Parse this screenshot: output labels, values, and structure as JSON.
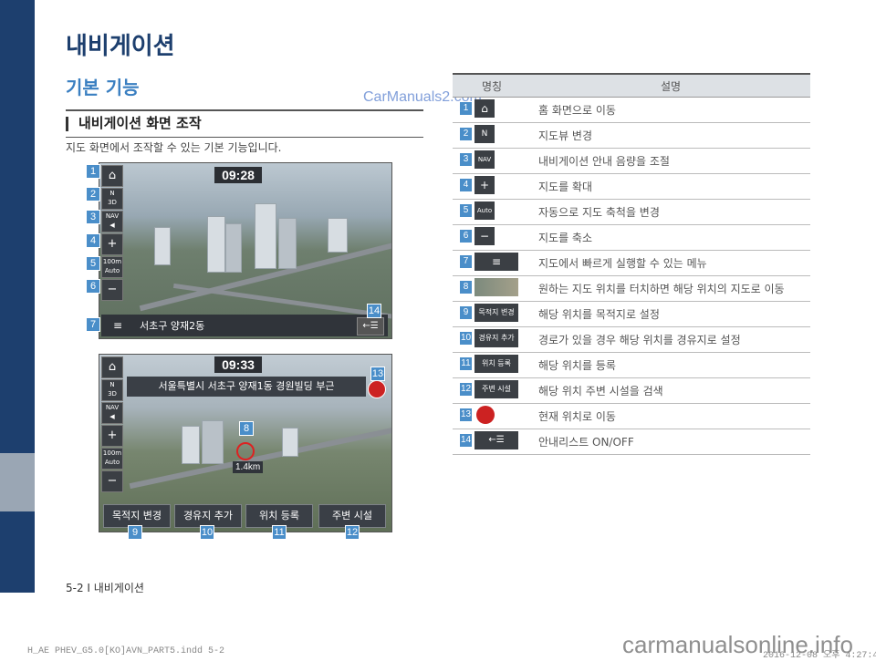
{
  "page_title": "내비게이션",
  "section_title": "기본 기능",
  "subsection_title": "내비게이션 화면 조작",
  "description": "지도 화면에서 조작할 수 있는 기본 기능입니다.",
  "watermark_top": "CarManuals2.com",
  "screen1": {
    "time": "09:28",
    "address": "서초구 양재2동",
    "scale_value": "100m",
    "scale_auto": "Auto",
    "nav_label": "NAV",
    "compass_label": "N",
    "compass_sub": "3D",
    "callouts": [
      "1",
      "2",
      "3",
      "4",
      "5",
      "6",
      "7",
      "14"
    ]
  },
  "screen2": {
    "time": "09:33",
    "address": "서울특별시 서초구 양재1동 경원빌딩 부근",
    "distance": "1.4km",
    "scale_value": "100m",
    "scale_auto": "Auto",
    "nav_label": "NAV",
    "compass_label": "N",
    "compass_sub": "3D",
    "buttons": [
      "목적지 변경",
      "경유지 추가",
      "위치 등록",
      "주변 시설"
    ],
    "callouts": [
      "8",
      "9",
      "10",
      "11",
      "12",
      "13"
    ]
  },
  "table": {
    "headers": [
      "명칭",
      "설명"
    ],
    "rows": [
      {
        "num": "1",
        "icon": "⌂",
        "desc": "홈 화면으로 이동"
      },
      {
        "num": "2",
        "icon": "N",
        "desc": "지도뷰 변경"
      },
      {
        "num": "3",
        "icon": "NAV",
        "desc": "내비게이션 안내 음량을 조절"
      },
      {
        "num": "4",
        "icon": "+",
        "desc": "지도를 확대"
      },
      {
        "num": "5",
        "icon": "Auto",
        "desc": "자동으로 지도 축척을 변경"
      },
      {
        "num": "6",
        "icon": "−",
        "desc": "지도를 축소"
      },
      {
        "num": "7",
        "icon": "≡",
        "desc": "지도에서 빠르게 실행할 수 있는 메뉴"
      },
      {
        "num": "8",
        "icon": "",
        "desc": "원하는 지도 위치를 터치하면 해당 위치의 지도로 이동"
      },
      {
        "num": "9",
        "icon": "목적지 변경",
        "desc": "해당 위치를 목적지로 설정"
      },
      {
        "num": "10",
        "icon": "경유지 추가",
        "desc": "경로가 있을 경우 해당 위치를 경유지로 설정"
      },
      {
        "num": "11",
        "icon": "위치 등록",
        "desc": "해당 위치를 등록"
      },
      {
        "num": "12",
        "icon": "주변 시설",
        "desc": "해당 위치 주변 시설을 검색"
      },
      {
        "num": "13",
        "icon": "",
        "desc": "현재 위치로 이동"
      },
      {
        "num": "14",
        "icon": "←☰",
        "desc": "안내리스트 ON/OFF"
      }
    ]
  },
  "footer": "5-2 I 내비게이션",
  "print_info": "H_AE PHEV_G5.0[KO]AVN_PART5.indd   5-2",
  "print_date": "2016-12-08   오후 4:27:4",
  "watermark_bottom": "carmanualsonline.info"
}
